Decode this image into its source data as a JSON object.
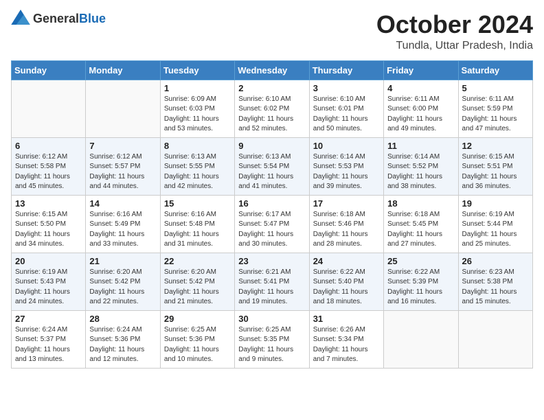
{
  "header": {
    "logo_general": "General",
    "logo_blue": "Blue",
    "month": "October 2024",
    "location": "Tundla, Uttar Pradesh, India"
  },
  "days_of_week": [
    "Sunday",
    "Monday",
    "Tuesday",
    "Wednesday",
    "Thursday",
    "Friday",
    "Saturday"
  ],
  "weeks": [
    [
      {
        "day": "",
        "info": ""
      },
      {
        "day": "",
        "info": ""
      },
      {
        "day": "1",
        "info": "Sunrise: 6:09 AM\nSunset: 6:03 PM\nDaylight: 11 hours and 53 minutes."
      },
      {
        "day": "2",
        "info": "Sunrise: 6:10 AM\nSunset: 6:02 PM\nDaylight: 11 hours and 52 minutes."
      },
      {
        "day": "3",
        "info": "Sunrise: 6:10 AM\nSunset: 6:01 PM\nDaylight: 11 hours and 50 minutes."
      },
      {
        "day": "4",
        "info": "Sunrise: 6:11 AM\nSunset: 6:00 PM\nDaylight: 11 hours and 49 minutes."
      },
      {
        "day": "5",
        "info": "Sunrise: 6:11 AM\nSunset: 5:59 PM\nDaylight: 11 hours and 47 minutes."
      }
    ],
    [
      {
        "day": "6",
        "info": "Sunrise: 6:12 AM\nSunset: 5:58 PM\nDaylight: 11 hours and 45 minutes."
      },
      {
        "day": "7",
        "info": "Sunrise: 6:12 AM\nSunset: 5:57 PM\nDaylight: 11 hours and 44 minutes."
      },
      {
        "day": "8",
        "info": "Sunrise: 6:13 AM\nSunset: 5:55 PM\nDaylight: 11 hours and 42 minutes."
      },
      {
        "day": "9",
        "info": "Sunrise: 6:13 AM\nSunset: 5:54 PM\nDaylight: 11 hours and 41 minutes."
      },
      {
        "day": "10",
        "info": "Sunrise: 6:14 AM\nSunset: 5:53 PM\nDaylight: 11 hours and 39 minutes."
      },
      {
        "day": "11",
        "info": "Sunrise: 6:14 AM\nSunset: 5:52 PM\nDaylight: 11 hours and 38 minutes."
      },
      {
        "day": "12",
        "info": "Sunrise: 6:15 AM\nSunset: 5:51 PM\nDaylight: 11 hours and 36 minutes."
      }
    ],
    [
      {
        "day": "13",
        "info": "Sunrise: 6:15 AM\nSunset: 5:50 PM\nDaylight: 11 hours and 34 minutes."
      },
      {
        "day": "14",
        "info": "Sunrise: 6:16 AM\nSunset: 5:49 PM\nDaylight: 11 hours and 33 minutes."
      },
      {
        "day": "15",
        "info": "Sunrise: 6:16 AM\nSunset: 5:48 PM\nDaylight: 11 hours and 31 minutes."
      },
      {
        "day": "16",
        "info": "Sunrise: 6:17 AM\nSunset: 5:47 PM\nDaylight: 11 hours and 30 minutes."
      },
      {
        "day": "17",
        "info": "Sunrise: 6:18 AM\nSunset: 5:46 PM\nDaylight: 11 hours and 28 minutes."
      },
      {
        "day": "18",
        "info": "Sunrise: 6:18 AM\nSunset: 5:45 PM\nDaylight: 11 hours and 27 minutes."
      },
      {
        "day": "19",
        "info": "Sunrise: 6:19 AM\nSunset: 5:44 PM\nDaylight: 11 hours and 25 minutes."
      }
    ],
    [
      {
        "day": "20",
        "info": "Sunrise: 6:19 AM\nSunset: 5:43 PM\nDaylight: 11 hours and 24 minutes."
      },
      {
        "day": "21",
        "info": "Sunrise: 6:20 AM\nSunset: 5:42 PM\nDaylight: 11 hours and 22 minutes."
      },
      {
        "day": "22",
        "info": "Sunrise: 6:20 AM\nSunset: 5:42 PM\nDaylight: 11 hours and 21 minutes."
      },
      {
        "day": "23",
        "info": "Sunrise: 6:21 AM\nSunset: 5:41 PM\nDaylight: 11 hours and 19 minutes."
      },
      {
        "day": "24",
        "info": "Sunrise: 6:22 AM\nSunset: 5:40 PM\nDaylight: 11 hours and 18 minutes."
      },
      {
        "day": "25",
        "info": "Sunrise: 6:22 AM\nSunset: 5:39 PM\nDaylight: 11 hours and 16 minutes."
      },
      {
        "day": "26",
        "info": "Sunrise: 6:23 AM\nSunset: 5:38 PM\nDaylight: 11 hours and 15 minutes."
      }
    ],
    [
      {
        "day": "27",
        "info": "Sunrise: 6:24 AM\nSunset: 5:37 PM\nDaylight: 11 hours and 13 minutes."
      },
      {
        "day": "28",
        "info": "Sunrise: 6:24 AM\nSunset: 5:36 PM\nDaylight: 11 hours and 12 minutes."
      },
      {
        "day": "29",
        "info": "Sunrise: 6:25 AM\nSunset: 5:36 PM\nDaylight: 11 hours and 10 minutes."
      },
      {
        "day": "30",
        "info": "Sunrise: 6:25 AM\nSunset: 5:35 PM\nDaylight: 11 hours and 9 minutes."
      },
      {
        "day": "31",
        "info": "Sunrise: 6:26 AM\nSunset: 5:34 PM\nDaylight: 11 hours and 7 minutes."
      },
      {
        "day": "",
        "info": ""
      },
      {
        "day": "",
        "info": ""
      }
    ]
  ]
}
